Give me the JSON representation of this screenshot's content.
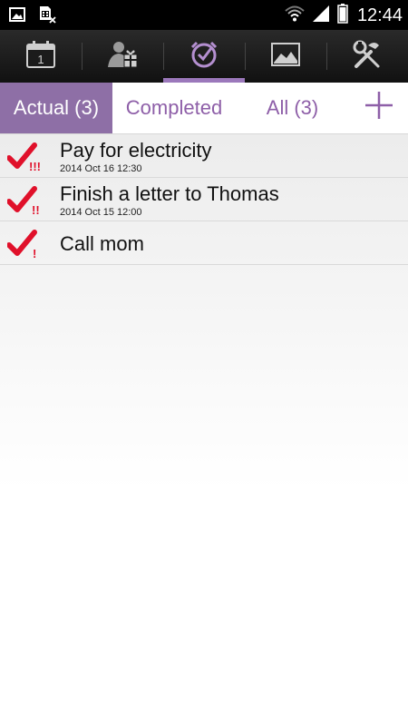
{
  "status_bar": {
    "time": "12:44",
    "icons": [
      "image-icon",
      "sim-card-icon",
      "wifi-icon",
      "signal-icon",
      "battery-icon"
    ]
  },
  "top_nav": {
    "items": [
      {
        "icon": "calendar-icon",
        "day": "1"
      },
      {
        "icon": "birthday-gift-icon"
      },
      {
        "icon": "tasks-clock-icon",
        "active": true
      },
      {
        "icon": "chart-image-icon"
      },
      {
        "icon": "tools-icon"
      }
    ]
  },
  "tabs": {
    "actual": "Actual (3)",
    "completed": "Completed",
    "all": "All (3)",
    "add_icon": "plus-icon"
  },
  "tasks": [
    {
      "title": "Pay for electricity",
      "date": "2014 Oct 16 12:30",
      "priority": "!!!"
    },
    {
      "title": "Finish a letter to Thomas",
      "date": "2014 Oct 15 12:00",
      "priority": "!!"
    },
    {
      "title": "Call mom",
      "date": "",
      "priority": "!"
    }
  ],
  "colors": {
    "accent": "#8e6fa6",
    "tab_text": "#8e5fa8",
    "check": "#e0102a"
  }
}
